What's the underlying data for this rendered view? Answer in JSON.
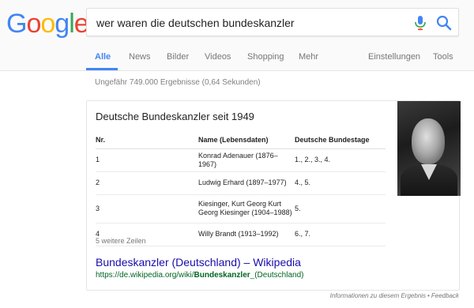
{
  "logo": {
    "letters": [
      "G",
      "o",
      "o",
      "g",
      "l",
      "e"
    ],
    "colors": [
      "#4285f4",
      "#ea4335",
      "#fbbc05",
      "#4285f4",
      "#34a853",
      "#ea4335"
    ]
  },
  "search": {
    "query": "wer waren die deutschen bundeskanzler"
  },
  "icons": {
    "mic": "microphone-icon",
    "search": "search-icon"
  },
  "tabs": [
    "Alle",
    "News",
    "Bilder",
    "Videos",
    "Shopping",
    "Mehr",
    "Einstellungen",
    "Tools"
  ],
  "stats": "Ungefähr 749.000 Ergebnisse (0,64 Sekunden)",
  "card": {
    "title": "Deutsche Bundeskanzler seit 1949",
    "headers": [
      "Nr.",
      "Name (Lebensdaten)",
      "Deutsche Bundestage"
    ],
    "rows": [
      [
        "1",
        "Konrad Adenauer (1876–1967)",
        "1., 2., 3., 4."
      ],
      [
        "2",
        "Ludwig Erhard (1897–1977)",
        "4., 5."
      ],
      [
        "3",
        "Kiesinger, Kurt Georg Kurt Georg Kiesinger (1904–1988)",
        "5."
      ],
      [
        "4",
        "Willy Brandt (1913–1992)",
        "6., 7."
      ]
    ],
    "more": "5 weitere Zeilen",
    "result_title": "Bundeskanzler (Deutschland) – Wikipedia",
    "result_url_prefix": "https://de.wikipedia.org/wiki/",
    "result_url_bold": "Bundeskanzler",
    "result_url_suffix": "_(Deutschland)"
  },
  "footer": {
    "info": "Informationen zu diesem Ergebnis",
    "sep": "•",
    "feedback": "Feedback"
  }
}
